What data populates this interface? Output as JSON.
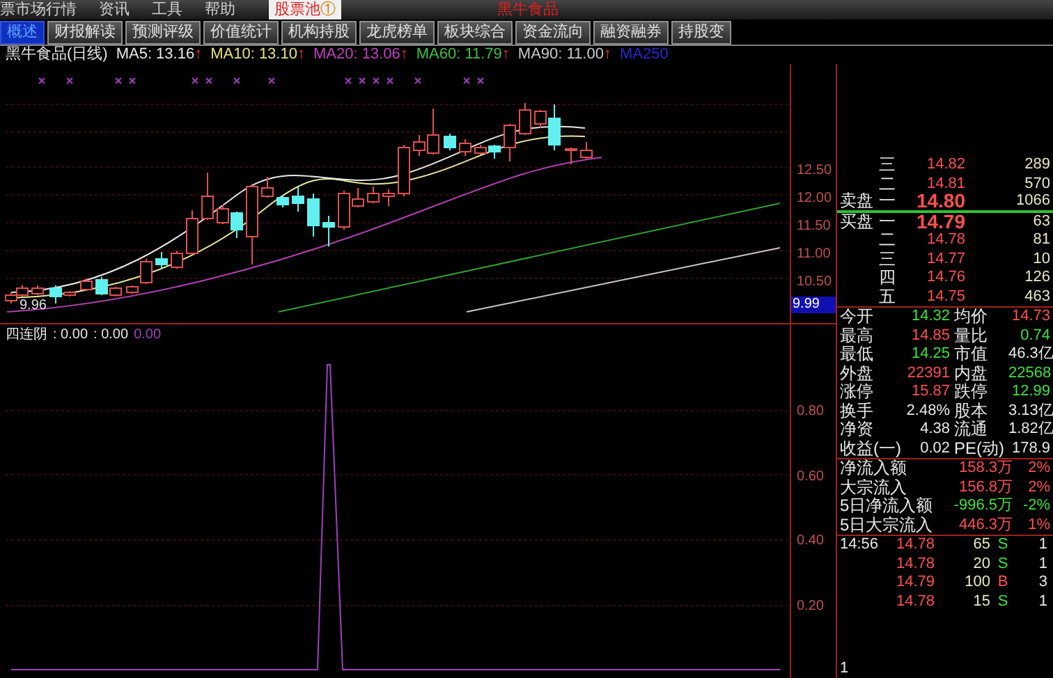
{
  "menu": [
    {
      "label": "票市场行情",
      "selected": false
    },
    {
      "label": "资讯",
      "selected": false
    },
    {
      "label": "工具",
      "selected": false
    },
    {
      "label": "帮助",
      "selected": false
    },
    {
      "label": "股票池",
      "badge": "①",
      "selected": true
    }
  ],
  "menu_note": "黑牛食品",
  "tabs": [
    {
      "label": "概述",
      "selected": true
    },
    {
      "label": "财报解读",
      "selected": false
    },
    {
      "label": "预测评级",
      "selected": false
    },
    {
      "label": "价值统计",
      "selected": false
    },
    {
      "label": "机构持股",
      "selected": false
    },
    {
      "label": "龙虎榜单",
      "selected": false
    },
    {
      "label": "板块综合",
      "selected": false
    },
    {
      "label": "资金流向",
      "selected": false
    },
    {
      "label": "融资融券",
      "selected": false
    },
    {
      "label": "持股变",
      "selected": false
    }
  ],
  "legend": {
    "title": "黑牛食品(日线)",
    "mas": [
      {
        "label": "MA5: 13.16",
        "arrow": "↑",
        "color": "#e8e8e8"
      },
      {
        "label": "MA10: 13.10",
        "arrow": "↑",
        "color": "#e8e080"
      },
      {
        "label": "MA20: 13.06",
        "arrow": "↑",
        "color": "#c040c0"
      },
      {
        "label": "MA60: 11.79",
        "arrow": "↑",
        "color": "#40c040"
      },
      {
        "label": "MA90: 11.00",
        "arrow": "↑",
        "color": "#c8c8c8"
      },
      {
        "label": "MA250",
        "color": "#2828d0"
      }
    ]
  },
  "price_axis": [
    "12.50",
    "12.00",
    "11.50",
    "11.00",
    "10.50"
  ],
  "price_marker": "9.99",
  "low_label": "9.96",
  "indicator": {
    "name": "四连阴",
    "values": [
      {
        "text": ": 0.00",
        "color": "#e8e8e8"
      },
      {
        "text": ": 0.00",
        "color": "#e8e8e8"
      },
      {
        "text": "0.00",
        "color": "#a040c0"
      }
    ]
  },
  "indicator_axis": [
    "0.80",
    "0.60",
    "0.40",
    "0.20"
  ],
  "order_book": [
    {
      "rank": "三",
      "price": "14.82",
      "volume": "289",
      "best": false
    },
    {
      "rank": "二",
      "price": "14.81",
      "volume": "570",
      "best": false
    },
    {
      "side": "卖盘",
      "rank": "一",
      "price": "14.80",
      "volume": "1066",
      "best": true
    },
    {
      "side": "买盘",
      "rank": "一",
      "price": "14.79",
      "volume": "63",
      "best": true
    },
    {
      "rank": "二",
      "price": "14.78",
      "volume": "81",
      "best": false
    },
    {
      "rank": "三",
      "price": "14.77",
      "volume": "10",
      "best": false
    },
    {
      "rank": "四",
      "price": "14.76",
      "volume": "126",
      "best": false
    },
    {
      "rank": "五",
      "price": "14.75",
      "volume": "463",
      "best": false
    }
  ],
  "stats": [
    {
      "cells": [
        {
          "label": "今开",
          "value": "14.32",
          "color": "#40e040"
        },
        {
          "label": "均价",
          "value": "14.73",
          "color": "#ff5050"
        }
      ]
    },
    {
      "cells": [
        {
          "label": "最高",
          "value": "14.85",
          "color": "#ff5050"
        },
        {
          "label": "量比",
          "value": "0.74",
          "color": "#40e040"
        }
      ]
    },
    {
      "cells": [
        {
          "label": "最低",
          "value": "14.25",
          "color": "#40e040"
        },
        {
          "label": "市值",
          "value": "46.3亿",
          "color": "#e8e8e8"
        }
      ]
    },
    {
      "cells": [
        {
          "label": "外盘",
          "value": "22391",
          "color": "#ff5050"
        },
        {
          "label": "内盘",
          "value": "22568",
          "color": "#40e040"
        }
      ]
    },
    {
      "cells": [
        {
          "label": "涨停",
          "value": "15.87",
          "color": "#ff5050"
        },
        {
          "label": "跌停",
          "value": "12.99",
          "color": "#40e040"
        }
      ]
    },
    {
      "cells": [
        {
          "label": "换手",
          "value": "2.48%",
          "color": "#e8e8e8"
        },
        {
          "label": "股本",
          "value": "3.13亿",
          "color": "#e8e8e8"
        }
      ]
    },
    {
      "cells": [
        {
          "label": "净资",
          "value": "4.38",
          "color": "#e8e8e8"
        },
        {
          "label": "流通",
          "value": "1.82亿",
          "color": "#e8e8e8"
        }
      ]
    },
    {
      "cells": [
        {
          "label": "收益(一)",
          "value": "0.02",
          "color": "#e8e8e8"
        },
        {
          "label": "PE(动)",
          "value": "178.9",
          "color": "#e8e8e8"
        }
      ]
    }
  ],
  "flows": [
    {
      "label": "净流入额",
      "amount": "158.3万",
      "pct": "2%",
      "color": "#ff5050"
    },
    {
      "label": "大宗流入",
      "amount": "156.8万",
      "pct": "2%",
      "color": "#ff5050"
    },
    {
      "label": "5日净流入额",
      "amount": "-996.5万",
      "pct": "-2%",
      "color": "#40e040"
    },
    {
      "label": "5日大宗流入",
      "amount": "446.3万",
      "pct": "1%",
      "color": "#ff5050"
    }
  ],
  "ticks": [
    {
      "time": "14:56",
      "price": "14.78",
      "volume": "65",
      "side": "S",
      "color": "#40e040",
      "count": "1"
    },
    {
      "price": "14.78",
      "volume": "20",
      "side": "S",
      "color": "#40e040",
      "count": "1"
    },
    {
      "price": "14.79",
      "volume": "100",
      "side": "B",
      "color": "#ff5050",
      "count": "3"
    },
    {
      "price": "14.78",
      "volume": "15",
      "side": "S",
      "color": "#40e040",
      "count": "1"
    }
  ],
  "footer": "1"
}
